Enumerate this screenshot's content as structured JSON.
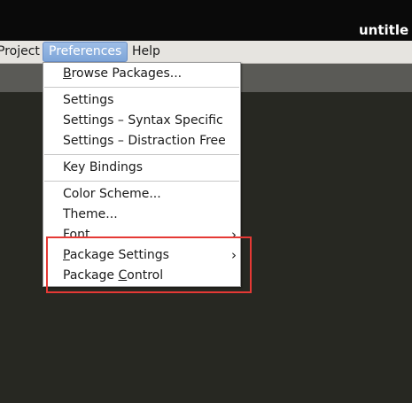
{
  "window": {
    "title": "untitle"
  },
  "menubar": {
    "items": [
      {
        "label": "Project"
      },
      {
        "label": "Preferences"
      },
      {
        "label": "Help"
      }
    ]
  },
  "preferences_menu": {
    "browse_packages": {
      "pre": "",
      "ul": "B",
      "post": "rowse Packages..."
    },
    "settings": "Settings",
    "settings_syntax": "Settings – Syntax Specific",
    "settings_distraction": "Settings – Distraction Free",
    "key_bindings": "Key Bindings",
    "color_scheme": "Color Scheme...",
    "theme": "Theme...",
    "font": "Font",
    "package_settings": {
      "pre": "",
      "ul": "P",
      "post": "ackage Settings"
    },
    "package_control": {
      "pre": "Package ",
      "ul": "C",
      "post": "ontrol"
    },
    "submenu_arrow": "›"
  },
  "colors": {
    "editor_bg": "#272822",
    "highlight": "#e53935",
    "menu_active": "#7ea5d8"
  }
}
